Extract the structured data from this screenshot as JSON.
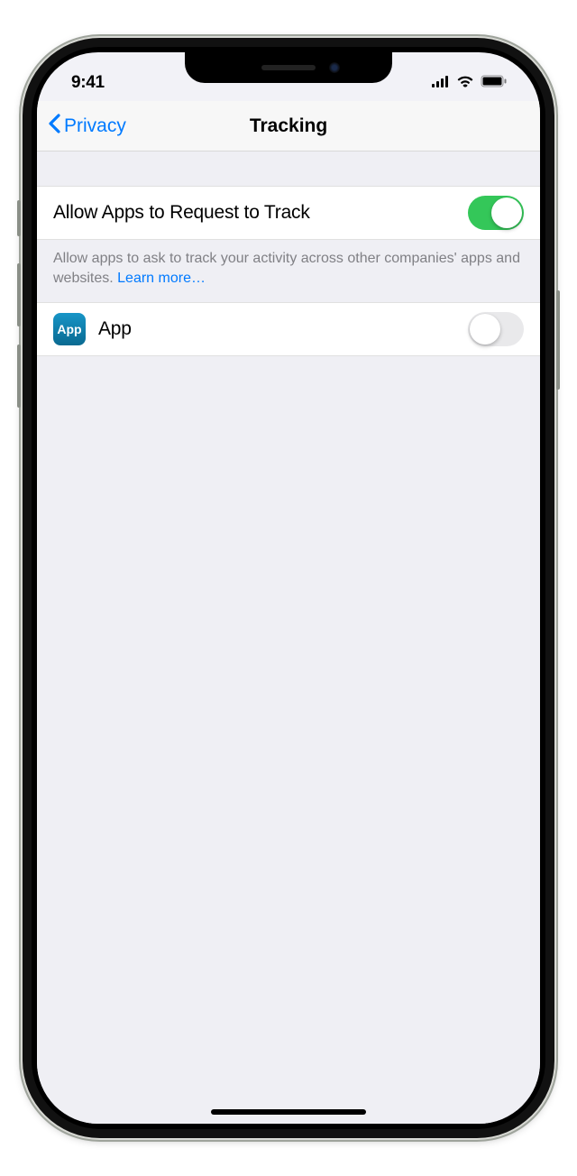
{
  "status": {
    "time": "9:41"
  },
  "nav": {
    "back_label": "Privacy",
    "title": "Tracking"
  },
  "allow_toggle": {
    "label": "Allow Apps to Request to Track",
    "enabled": true
  },
  "footer": {
    "text": "Allow apps to ask to track your activity across other companies' apps and websites. ",
    "link": "Learn more…"
  },
  "apps": [
    {
      "icon_label": "App",
      "name": "App",
      "enabled": false
    }
  ]
}
